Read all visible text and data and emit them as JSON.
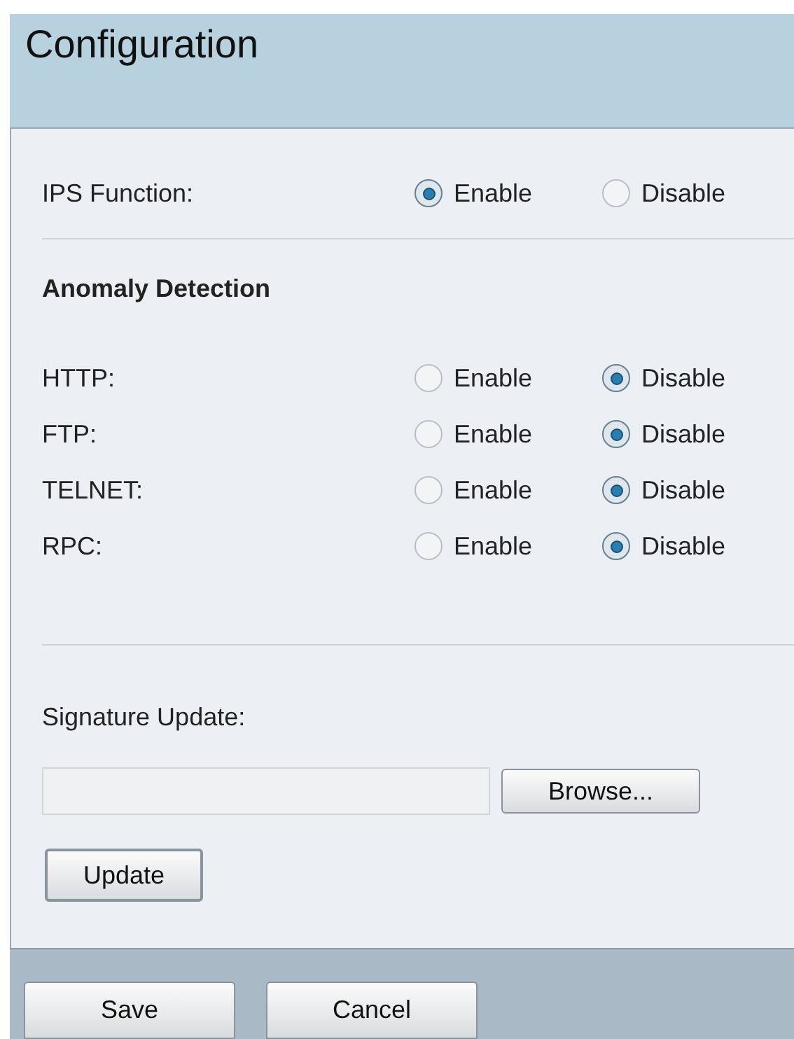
{
  "title": "Configuration",
  "ips_function": {
    "label": "IPS Function:",
    "options": [
      {
        "label": "Enable",
        "selected": true
      },
      {
        "label": "Disable",
        "selected": false
      }
    ]
  },
  "anomaly_detection": {
    "heading": "Anomaly Detection",
    "protocols": [
      {
        "label": "HTTP:",
        "options": [
          {
            "label": "Enable",
            "selected": false
          },
          {
            "label": "Disable",
            "selected": true
          }
        ]
      },
      {
        "label": "FTP:",
        "options": [
          {
            "label": "Enable",
            "selected": false
          },
          {
            "label": "Disable",
            "selected": true
          }
        ]
      },
      {
        "label": "TELNET:",
        "options": [
          {
            "label": "Enable",
            "selected": false
          },
          {
            "label": "Disable",
            "selected": true
          }
        ]
      },
      {
        "label": "RPC:",
        "options": [
          {
            "label": "Enable",
            "selected": false
          },
          {
            "label": "Disable",
            "selected": true
          }
        ]
      }
    ]
  },
  "signature_update": {
    "label": "Signature Update:",
    "browse_button": "Browse...",
    "update_button": "Update"
  },
  "footer_buttons": [
    "Save",
    "Cancel"
  ]
}
